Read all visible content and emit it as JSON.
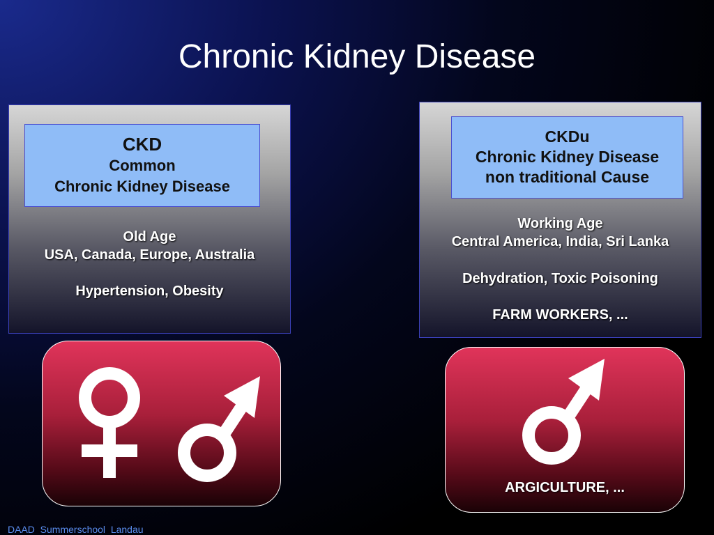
{
  "slide": {
    "title": "Chronic Kidney Disease",
    "footer": "DAAD  Summerschool  Landau"
  },
  "left_panel": {
    "header": [
      "CKD",
      "Common",
      "Chronic Kidney Disease"
    ],
    "lines": [
      "Old Age",
      "USA, Canada, Europe, Australia",
      "",
      "Hypertension, Obesity"
    ]
  },
  "right_panel": {
    "header": [
      "CKDu",
      "Chronic Kidney Disease",
      "non traditional Cause"
    ],
    "lines": [
      "Working Age",
      "Central America, India,  Sri Lanka",
      "",
      "Dehydration, Toxic Poisoning",
      "",
      "FARM WORKERS, ..."
    ]
  },
  "left_icon_box": {
    "icons": [
      "female-symbol-icon",
      "male-symbol-icon"
    ]
  },
  "right_icon_box": {
    "icons": [
      "male-symbol-icon"
    ],
    "caption": "ARGICULTURE, ..."
  },
  "colors": {
    "header_box": "#8fbcf7",
    "panel_border": "#3b40b8",
    "icon_box_top": "#e0345a",
    "icon_box_bottom": "#1a0206",
    "footer_text": "#5b8ef0"
  }
}
